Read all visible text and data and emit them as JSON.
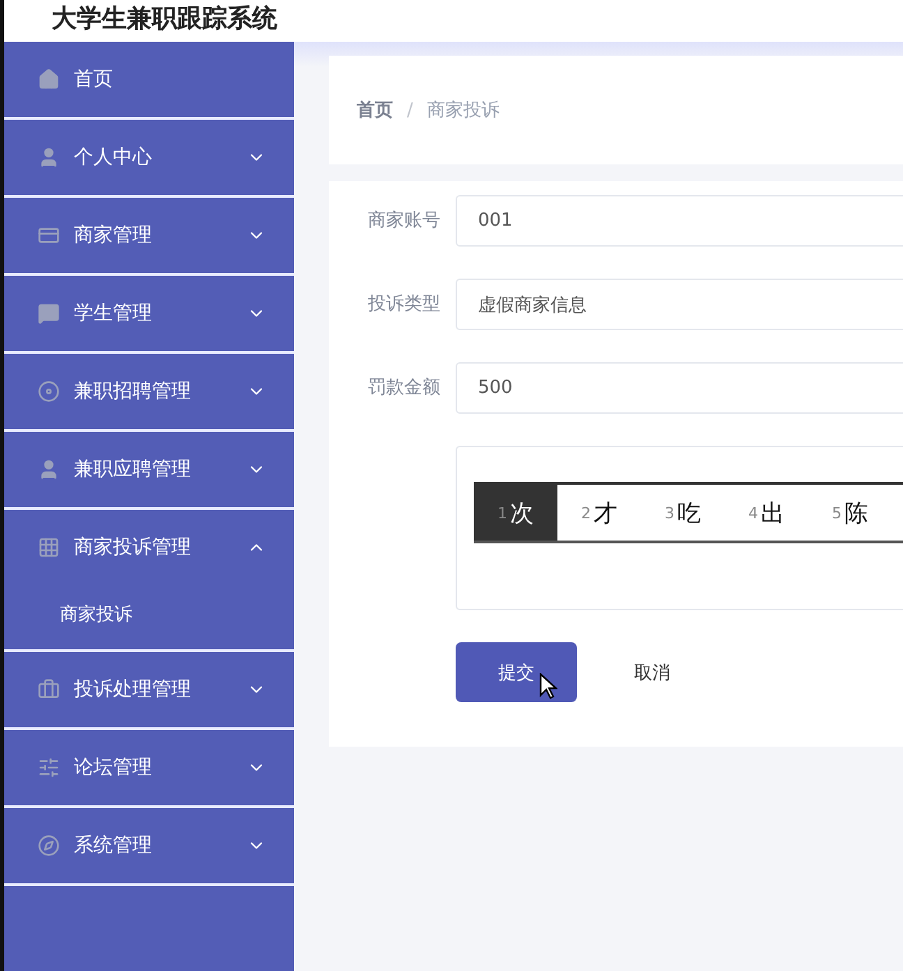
{
  "app_title": "大学生兼职跟踪系统",
  "sidebar": {
    "items": [
      {
        "label": "首页",
        "expandable": false
      },
      {
        "label": "个人中心",
        "expandable": true,
        "expanded": false
      },
      {
        "label": "商家管理",
        "expandable": true,
        "expanded": false
      },
      {
        "label": "学生管理",
        "expandable": true,
        "expanded": false
      },
      {
        "label": "兼职招聘管理",
        "expandable": true,
        "expanded": false
      },
      {
        "label": "兼职应聘管理",
        "expandable": true,
        "expanded": false
      },
      {
        "label": "商家投诉管理",
        "expandable": true,
        "expanded": true,
        "children": [
          {
            "label": "商家投诉"
          }
        ]
      },
      {
        "label": "投诉处理管理",
        "expandable": true,
        "expanded": false
      },
      {
        "label": "论坛管理",
        "expandable": true,
        "expanded": false
      },
      {
        "label": "系统管理",
        "expandable": true,
        "expanded": false
      }
    ]
  },
  "breadcrumb": [
    "首页",
    "商家投诉"
  ],
  "breadcrumb_separator": "/",
  "form": {
    "fields": [
      {
        "kind": "input",
        "label": "商家账号",
        "value": "001"
      },
      {
        "kind": "input",
        "label": "投诉类型",
        "value": "虚假商家信息"
      },
      {
        "kind": "input",
        "label": "罚款金额",
        "value": "500"
      },
      {
        "kind": "textarea"
      }
    ],
    "ime_candidates": [
      {
        "index": "1",
        "text": "次",
        "selected": true
      },
      {
        "index": "2",
        "text": "才",
        "selected": false
      },
      {
        "index": "3",
        "text": "吃",
        "selected": false
      },
      {
        "index": "4",
        "text": "出",
        "selected": false
      },
      {
        "index": "5",
        "text": "陈",
        "selected": false
      }
    ],
    "buttons": [
      {
        "kind": "primary",
        "label": "提交"
      },
      {
        "kind": "plain",
        "label": "取消"
      }
    ]
  }
}
